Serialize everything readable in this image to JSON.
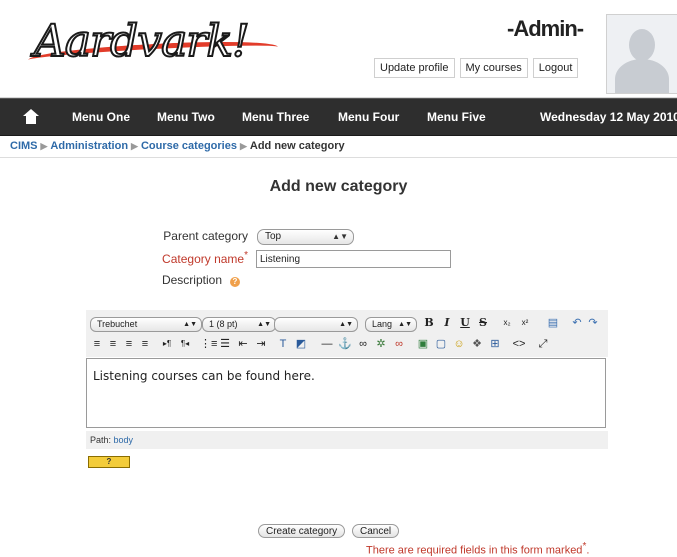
{
  "header": {
    "logo_text": "Aardvark!",
    "user_title": "-Admin-",
    "links": [
      "Update profile",
      "My courses",
      "Logout"
    ]
  },
  "nav": {
    "items": [
      "Menu One",
      "Menu Two",
      "Menu Three",
      "Menu Four",
      "Menu Five"
    ],
    "date": "Wednesday 12 May 2010"
  },
  "breadcrumb": {
    "items": [
      "CIMS",
      "Administration",
      "Course categories",
      "Add new category"
    ]
  },
  "form": {
    "title": "Add new category",
    "parent_label": "Parent category",
    "parent_value": "Top",
    "name_label": "Category name",
    "name_value": "Listening",
    "description_label": "Description",
    "help_glyph": "?",
    "required_marker": "*"
  },
  "editor": {
    "font_family": "Trebuchet",
    "font_size": "1 (8 pt)",
    "format": "",
    "lang": "Lang",
    "content": "Listening courses can be found here.",
    "path_label": "Path:",
    "path_value": "body",
    "toggle_label": "? "
  },
  "buttons": {
    "create": "Create category",
    "cancel": "Cancel"
  },
  "notice": {
    "text": "There are required fields in this form marked",
    "marker": "*"
  },
  "colors": {
    "nav_bg": "#2e2e2e",
    "link": "#2e6aa8",
    "required": "#c0392b",
    "accent_red": "#e23c2a"
  }
}
